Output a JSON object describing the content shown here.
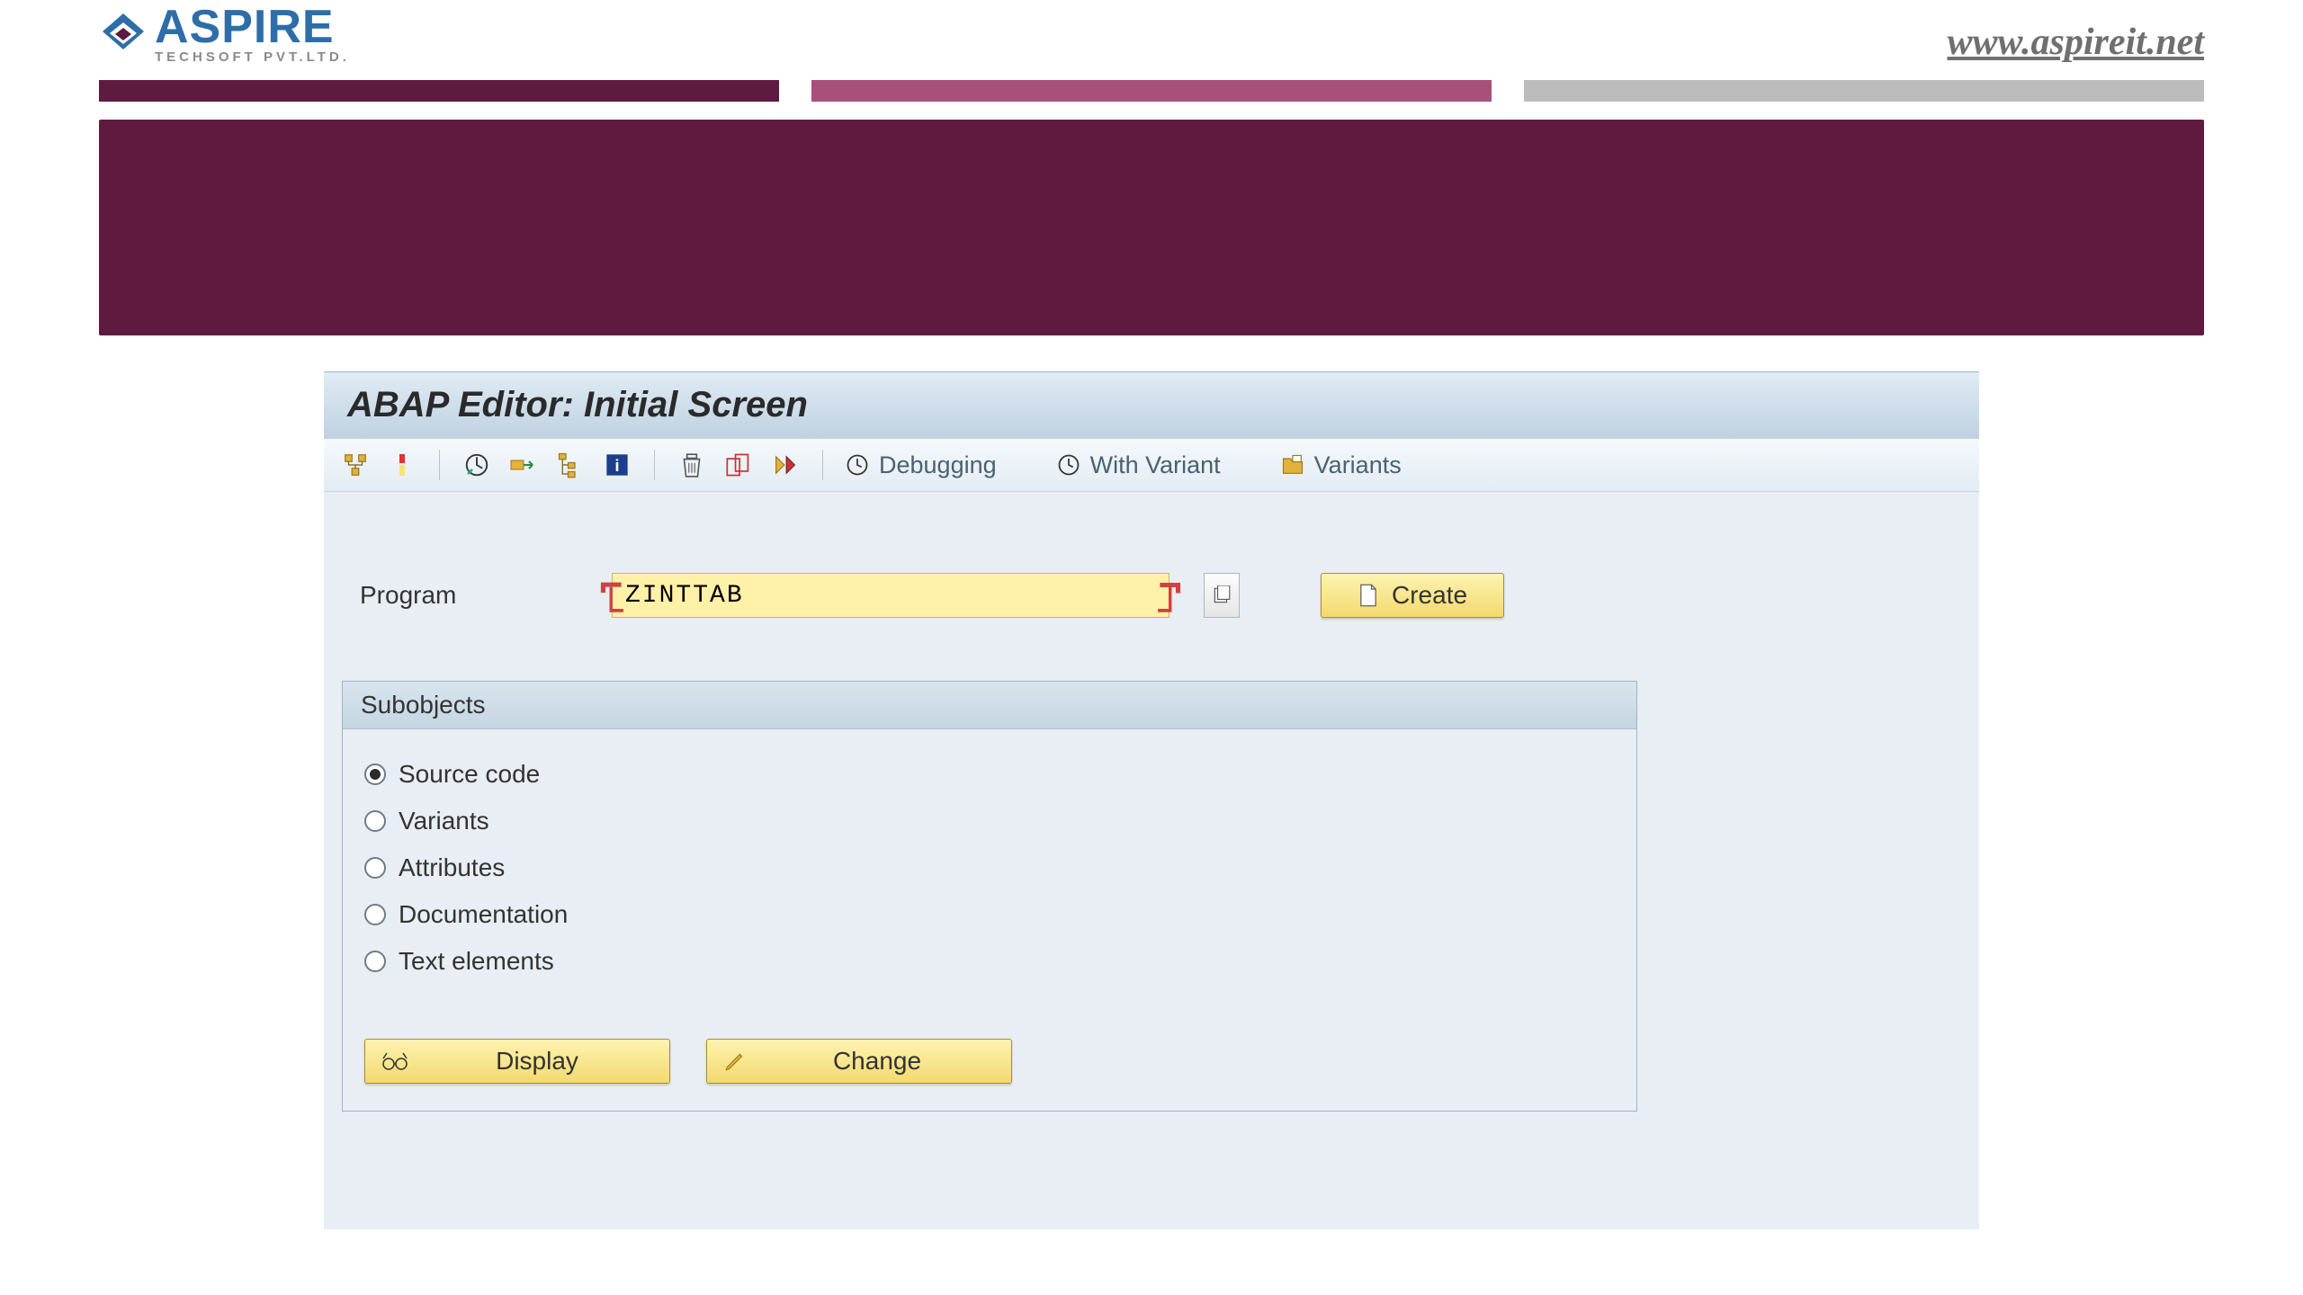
{
  "slide": {
    "logo_name": "ASPIRE",
    "logo_sub": "TECHSOFT PVT.LTD.",
    "url": "www.aspireit.net"
  },
  "sap": {
    "title": "ABAP Editor: Initial Screen",
    "toolbar": {
      "debugging": "Debugging",
      "with_variant": "With Variant",
      "variants": "Variants"
    },
    "program_label": "Program",
    "program_value": "ZINTTAB",
    "create_label": "Create",
    "subobjects_title": "Subobjects",
    "subobjects": [
      {
        "label": "Source code",
        "checked": true
      },
      {
        "label": "Variants",
        "checked": false
      },
      {
        "label": "Attributes",
        "checked": false
      },
      {
        "label": "Documentation",
        "checked": false
      },
      {
        "label": "Text elements",
        "checked": false
      }
    ],
    "display_label": "Display",
    "change_label": "Change"
  }
}
